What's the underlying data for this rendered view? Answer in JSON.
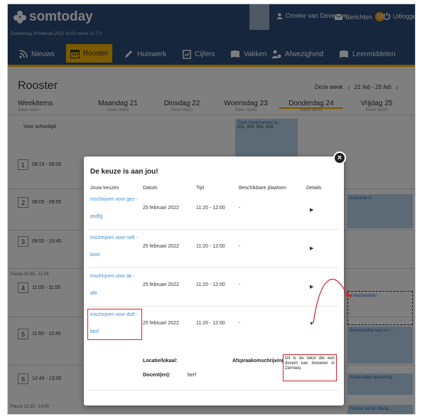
{
  "header": {
    "brand": "somtoday",
    "user_name": "Omeke van Deventer",
    "messages_label": "Berichten",
    "messages_count": "12",
    "logout_label": "Uitloggen",
    "dateline": "Donderdag 24 februari 2022 10:02 versie 12.7.0"
  },
  "nav": {
    "items": [
      {
        "label": "Nieuws"
      },
      {
        "label": "Rooster"
      },
      {
        "label": "Huiswerk"
      },
      {
        "label": "Cijfers"
      },
      {
        "label": "Vakken"
      },
      {
        "label": "Afwezigheid"
      },
      {
        "label": "Leermiddelen"
      }
    ]
  },
  "rooster": {
    "title": "Rooster",
    "week_label": "Deze week",
    "week_range": "21 feb - 25 feb",
    "columns": [
      {
        "head": "Weekitems",
        "sub": "Geen items"
      },
      {
        "head": "Maandag 21",
        "sub": "Geen items"
      },
      {
        "head": "Dinsdag 22",
        "sub": "Geen items"
      },
      {
        "head": "Woensdag 23",
        "sub": "Geen items"
      },
      {
        "head": "Donderdag 24",
        "sub": "Geen items"
      },
      {
        "head": "Vrijdag 25",
        "sub": "Geen items"
      }
    ],
    "voor_schooltijd": "Voor schooltijd",
    "rows": [
      {
        "num": "1",
        "time": "08:15 - 09:05"
      },
      {
        "num": "2",
        "time": "09:05 - 09:55"
      },
      {
        "num": "3",
        "time": "09:55 - 10:45"
      },
      {
        "num": "4",
        "time": "11:05 - 11:55"
      },
      {
        "num": "5",
        "time": "11:55 - 12:45"
      },
      {
        "num": "6",
        "time": "12:45 - 13:35"
      }
    ],
    "pauzes": [
      "Pauze 10:45 - 11:05",
      "Pauze 13:35 - 14:00"
    ],
    "blocks": {
      "toets_title": "Toets Nederlandse ta...",
      "toets_codes": "001, 004, 002, 003",
      "wiskunde": "wiskunde A",
      "keuzeopties": "4 keuzeopties",
      "nederlands": "Nederlandse taal en l...",
      "lichamelijke": "lichamelijke opvoeding",
      "frans": "Franse taal en literat..."
    }
  },
  "modal": {
    "title": "De keuze is aan jou!",
    "close": "×",
    "headers": {
      "keuzes": "Jouw keuzes",
      "datum": "Datum",
      "tijd": "Tijd",
      "plaatsen": "Beschikbare plaatsen",
      "details": "Details"
    },
    "rows": [
      {
        "link1": "Inschrijven voor ges -",
        "link2": "asdfg",
        "datum": "25 februari 2022",
        "tijd": "11:20 - 12:00",
        "plaatsen": "-",
        "arrow": "▶"
      },
      {
        "link1": "Inschrijven voor netl -",
        "link2": "bool",
        "datum": "25 februari 2022",
        "tijd": "11:20 - 12:00",
        "plaatsen": "-",
        "arrow": "▶"
      },
      {
        "link1": "Inschrijven voor ak -",
        "link2": "afe",
        "datum": "25 februari 2022",
        "tijd": "11:20 - 12:00",
        "plaatsen": "-",
        "arrow": "▶"
      },
      {
        "link1": "Inschrijven voor dutl -",
        "link2": "berf",
        "datum": "25 februari 2022",
        "tijd": "11:20 - 12:00",
        "plaatsen": "-",
        "arrow": "▼"
      }
    ],
    "detail": {
      "locatie_label": "Locatie/lokaal:",
      "docent_label": "Docent(en):",
      "docent_value": "berf",
      "afspraak_label": "Afspraakomschrijving:",
      "afspraak_text": "Dit is de tekst die een docent kan invoeren in Zermelo."
    }
  },
  "colors": {
    "header_bg": "#2a4d7a",
    "accent": "#f5b700",
    "link": "#3a8ed8",
    "annotation_red": "#d9202a"
  }
}
